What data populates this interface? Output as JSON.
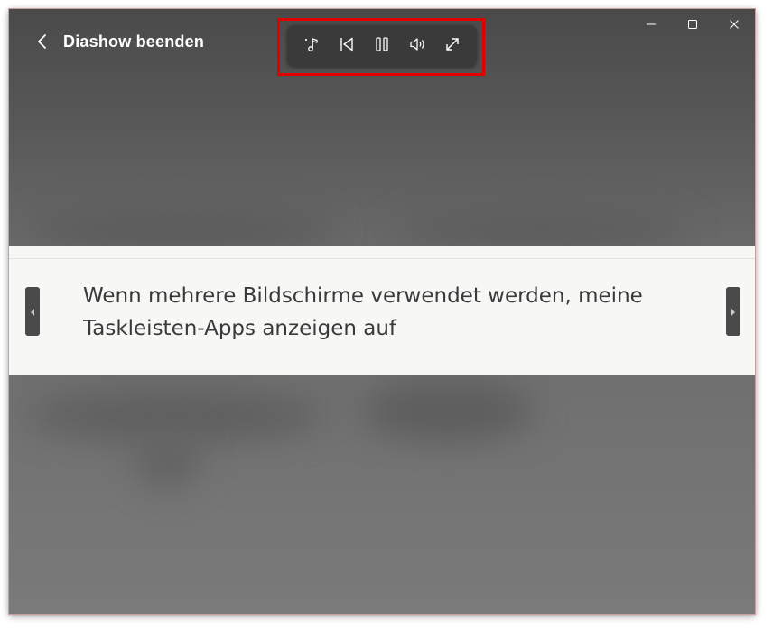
{
  "slideshow": {
    "exit_label": "Diashow beenden"
  },
  "toolbar": {
    "items": [
      {
        "name": "music-icon"
      },
      {
        "name": "previous-icon"
      },
      {
        "name": "pause-icon"
      },
      {
        "name": "volume-icon"
      },
      {
        "name": "fullscreen-icon"
      }
    ]
  },
  "window_controls": [
    "minimize-icon",
    "maximize-icon",
    "close-icon"
  ],
  "caption": {
    "line1": "Wenn mehrere Bildschirme verwendet werden, meine",
    "line2": "Taskleisten-Apps anzeigen auf"
  },
  "colors": {
    "highlight": "#e00000",
    "toolbar_bg": "#3a3a3a",
    "caption_bg": "#f7f7f5"
  }
}
